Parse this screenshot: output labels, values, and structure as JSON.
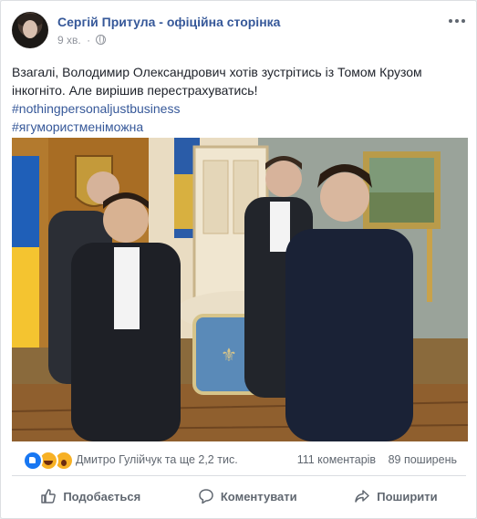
{
  "post": {
    "author": "Сергій Притула - офіційна сторінка",
    "time": "9 хв.",
    "separator": "·",
    "text_lines": [
      "Взагалі, Володимир Олександрович хотів зустрітись із Томом Крузом",
      "інкогніто. Але вирішив перестрахуватись!"
    ],
    "hashtags": [
      "#nothingpersonaljustbusiness",
      "#ягумористменіможна"
    ],
    "icons": {
      "privacy": "globe-icon",
      "menu": "more-options-icon"
    }
  },
  "reactions": {
    "types": [
      "like",
      "haha",
      "wow"
    ],
    "colors": {
      "like": "#1877f2",
      "haha": "#f7b125",
      "wow": "#f7b125"
    },
    "names": "Дмитро Гулійчук та ще 2,2 тис.",
    "comments": "111 коментарів",
    "shares": "89 поширень"
  },
  "actions": {
    "like_label": "Подобається",
    "comment_label": "Коментувати",
    "share_label": "Поширити"
  },
  "theme": {
    "link_color": "#365899",
    "text_color": "#1d2129",
    "muted_color": "#606770"
  }
}
